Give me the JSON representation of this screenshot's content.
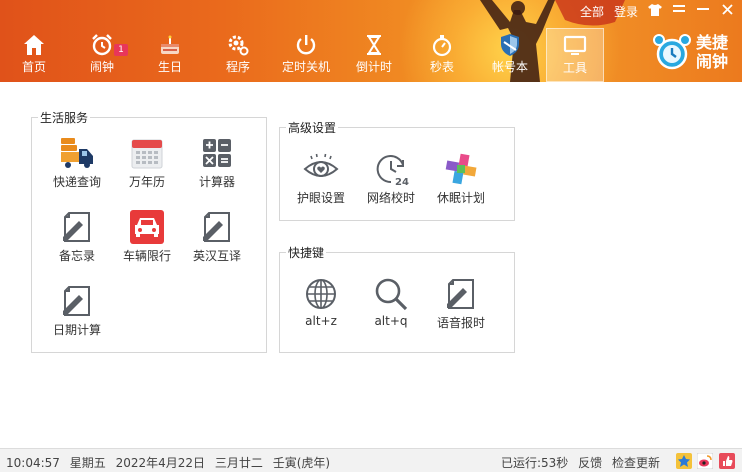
{
  "topbar": {
    "all": "全部",
    "login": "登录",
    "skin_icon": "tshirt-icon",
    "menu_icon": "menu-icon",
    "minimize_icon": "minimize-icon",
    "close_icon": "close-icon"
  },
  "nav": [
    {
      "label": "首页",
      "icon": "home-icon"
    },
    {
      "label": "闹钟",
      "icon": "alarm-clock-icon",
      "badge": "1"
    },
    {
      "label": "生日",
      "icon": "birthday-cake-icon"
    },
    {
      "label": "程序",
      "icon": "gear-icon"
    },
    {
      "label": "定时关机",
      "icon": "power-icon"
    },
    {
      "label": "倒计时",
      "icon": "hourglass-icon"
    },
    {
      "label": "秒表",
      "icon": "stopwatch-icon"
    },
    {
      "label": "帐号本",
      "icon": "shield-icon"
    },
    {
      "label": "工具",
      "icon": "monitor-icon",
      "active": true
    }
  ],
  "logo": {
    "line1": "美捷",
    "line2": "闹钟"
  },
  "life": {
    "title": "生活服务",
    "items": [
      {
        "label": "快递查询",
        "icon": "delivery-truck-icon"
      },
      {
        "label": "万年历",
        "icon": "calendar-icon"
      },
      {
        "label": "计算器",
        "icon": "calculator-icon"
      },
      {
        "label": "备忘录",
        "icon": "note-edit-icon"
      },
      {
        "label": "车辆限行",
        "icon": "car-icon"
      },
      {
        "label": "英汉互译",
        "icon": "note-edit-icon"
      },
      {
        "label": "日期计算",
        "icon": "note-edit-icon"
      }
    ]
  },
  "advanced": {
    "title": "高级设置",
    "items": [
      {
        "label": "护眼设置",
        "icon": "eye-heart-icon"
      },
      {
        "label": "网络校时",
        "icon": "clock-24-icon"
      },
      {
        "label": "休眠计划",
        "icon": "pinwheel-icon"
      }
    ]
  },
  "shortcuts": {
    "title": "快捷键",
    "items": [
      {
        "label": "alt+z",
        "icon": "globe-icon"
      },
      {
        "label": "alt+q",
        "icon": "magnifier-icon"
      },
      {
        "label": "语音报时",
        "icon": "note-edit-icon"
      }
    ]
  },
  "status": {
    "time": "10:04:57",
    "weekday": "星期五",
    "date": "2022年4月22日",
    "lunar": "三月廿二",
    "ganzhi": "壬寅(虎年)",
    "running": "已运行:53秒",
    "feedback": "反馈",
    "update": "检查更新"
  },
  "colors": {
    "header_orange": "#ea6a1c",
    "badge": "#e8365a",
    "car_red": "#e83a3a"
  }
}
